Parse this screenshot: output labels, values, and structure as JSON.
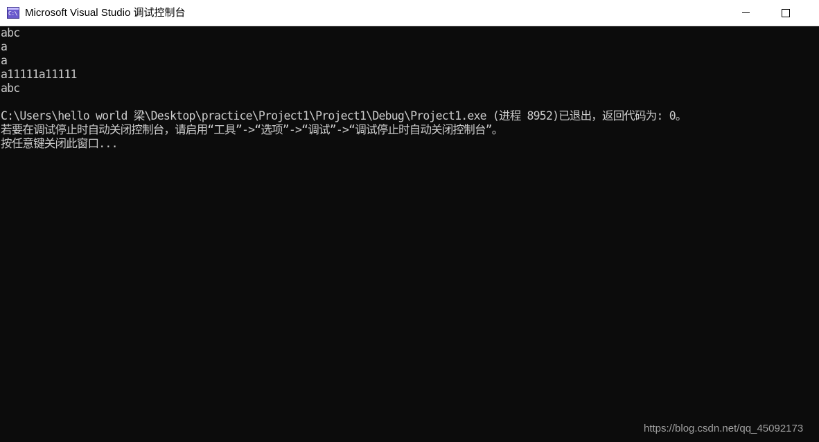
{
  "window": {
    "title": "Microsoft Visual Studio 调试控制台",
    "icon": "console-app-icon",
    "icon_label": "C:\\",
    "controls": [
      "minimize",
      "maximize"
    ]
  },
  "console": {
    "lines": [
      "abc",
      "a",
      "a",
      "a11111a11111",
      "abc",
      "",
      "C:\\Users\\hello world 梁\\Desktop\\practice\\Project1\\Project1\\Debug\\Project1.exe (进程 8952)已退出，返回代码为: 0。",
      "若要在调试停止时自动关闭控制台，请启用“工具”->“选项”->“调试”->“调试停止时自动关闭控制台”。",
      "按任意键关闭此窗口..."
    ]
  },
  "watermark": {
    "text": "https://blog.csdn.net/qq_45092173"
  },
  "colors": {
    "console_bg": "#0c0c0c",
    "console_fg": "#cccccc",
    "titlebar_bg": "#ffffff"
  }
}
